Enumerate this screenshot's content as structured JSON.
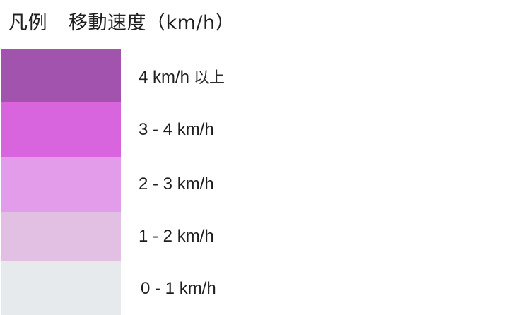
{
  "legend": {
    "title_prefix": "凡例",
    "title_main": "移動速度（km/h）",
    "items": [
      {
        "label": "4 km/h",
        "suffix": "以上",
        "color": "#a153ad"
      },
      {
        "label": "3 - 4 km/h",
        "suffix": "",
        "color": "#d865dd"
      },
      {
        "label": "2 - 3 km/h",
        "suffix": "",
        "color": "#e29ce9"
      },
      {
        "label": "1 - 2 km/h",
        "suffix": "",
        "color": "#e1c0e4"
      },
      {
        "label": "0 - 1 km/h",
        "suffix": "",
        "color": "#e7eaec"
      }
    ]
  }
}
